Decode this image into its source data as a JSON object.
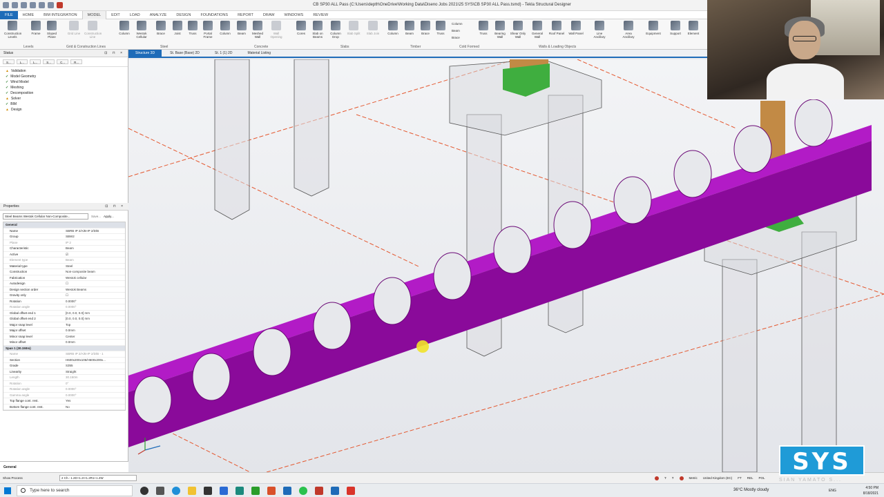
{
  "window": {
    "title": "CB SP30 ALL Pass (C:\\Users\\depth\\OneDrive\\Working Data\\Diseno Jobs 2021\\25 SYS\\CB SP30 ALL Pass.tsmd) - Tekla Structural Designer"
  },
  "menu_tabs": [
    "FILE",
    "HOME",
    "BIM INTEGRATION",
    "MODEL",
    "EDIT",
    "LOAD",
    "ANALYZE",
    "DESIGN",
    "FOUNDATIONS",
    "REPORT",
    "DRAW",
    "WINDOWS",
    "REVIEW"
  ],
  "ribbon": {
    "buttons": [
      {
        "label": "Construction Levels"
      },
      {
        "label": "Frame"
      },
      {
        "label": "Sloped Plane"
      },
      {
        "label": "Grid Line",
        "dim": true
      },
      {
        "label": "Construction Line",
        "dim": true
      },
      {
        "label": "Column"
      },
      {
        "label": "Westok Cellular"
      },
      {
        "label": "Brace"
      },
      {
        "label": "Joist"
      },
      {
        "label": "Truss"
      },
      {
        "label": "Portal Frame"
      },
      {
        "label": "Column"
      },
      {
        "label": "Beam"
      },
      {
        "label": "Meshed Wall"
      },
      {
        "label": "Wall Opening",
        "dim": true
      },
      {
        "label": "Cores"
      },
      {
        "label": "Slab on Beams"
      },
      {
        "label": "Column Drop"
      },
      {
        "label": "Slab Split",
        "dim": true
      },
      {
        "label": "Slab Join",
        "dim": true
      },
      {
        "label": "Column"
      },
      {
        "label": "Beam"
      },
      {
        "label": "Brace"
      },
      {
        "label": "Truss"
      },
      {
        "label": "Truss"
      },
      {
        "label": "Bearing Wall"
      },
      {
        "label": "Shear Only Wall"
      },
      {
        "label": "General Wall"
      },
      {
        "label": "Roof Panel"
      },
      {
        "label": "Wall Panel"
      },
      {
        "label": "Line Ancillary"
      },
      {
        "label": "Area Ancillary"
      },
      {
        "label": "Equipment"
      },
      {
        "label": "Support"
      },
      {
        "label": "Element"
      }
    ],
    "cold_formed_items": [
      "Column",
      "Beam",
      "Brace"
    ],
    "groups": [
      "Levels",
      "Grid & Construction Lines",
      "Steel",
      "Concrete",
      "Slabs",
      "Timber",
      "Cold Formed",
      "Walls & Loading Objects"
    ]
  },
  "status_panel": {
    "title": "Status",
    "controls": "⊡ ⊓ ×",
    "mini_tabs": [
      "S...",
      "L...",
      "L...",
      "S...",
      "C...",
      "R..."
    ],
    "tree": [
      {
        "icon": "warning",
        "label": "Validation"
      },
      {
        "icon": "check",
        "label": "Model Geometry"
      },
      {
        "icon": "check",
        "label": "Wind Model"
      },
      {
        "icon": "check",
        "label": "Meshing"
      },
      {
        "icon": "check",
        "label": "Decomposition"
      },
      {
        "icon": "warning",
        "label": "Solver"
      },
      {
        "icon": "check",
        "label": "BIM"
      },
      {
        "icon": "warning",
        "label": "Design"
      }
    ]
  },
  "properties_panel": {
    "title": "Properties",
    "controls": "⊡ ⊓ ×",
    "selector": "Steel Beams Westok Cellular Non-Composite...",
    "save_label": "Save...",
    "apply_label": "Apply...",
    "rows": [
      {
        "k": "General",
        "sec": true
      },
      {
        "k": "Name",
        "v": "SBRB IP 2/A/B-IP 2/D/B"
      },
      {
        "k": "Group",
        "v": "SBW2"
      },
      {
        "k": "Plane",
        "v": "IP 2",
        "dim": true
      },
      {
        "k": "Characteristic",
        "v": "Beam"
      },
      {
        "k": "Active",
        "v": "☑"
      },
      {
        "k": "Element type",
        "v": "Beam",
        "dim": true
      },
      {
        "k": "Material type",
        "v": "Steel"
      },
      {
        "k": "Construction",
        "v": "Non-composite beam"
      },
      {
        "k": "Fabrication",
        "v": "Westok cellular"
      },
      {
        "k": "Autodesign",
        "v": "☐"
      },
      {
        "k": "Design section order",
        "v": "Westok Beams"
      },
      {
        "k": "Gravity only",
        "v": "☐"
      },
      {
        "k": "Rotation",
        "v": "0.0000°"
      },
      {
        "k": "Rotation angle",
        "v": "0.0000°",
        "dim": true
      },
      {
        "k": "Global offset end 1",
        "v": "[0.0, 0.0, 0.0] mm"
      },
      {
        "k": "Global offset end 2",
        "v": "[0.0, 0.0, 0.0] mm"
      },
      {
        "k": "Major snap level",
        "v": "Top"
      },
      {
        "k": "Major offset",
        "v": "0.0mm"
      },
      {
        "k": "Minor snap level",
        "v": "Center"
      },
      {
        "k": "Minor offset",
        "v": "0.0mm"
      },
      {
        "k": "Span 1 (30.150m)",
        "sec": true
      },
      {
        "k": "Name",
        "v": "SBRB IP 2/A/B-IP 2/D/B - 1",
        "dim": true
      },
      {
        "k": "Section",
        "v": "H600x200x106/H600x200x..."
      },
      {
        "k": "Grade",
        "v": "S355"
      },
      {
        "k": "Linearity",
        "v": "Straight"
      },
      {
        "k": "Length",
        "v": "30.150m",
        "dim": true
      },
      {
        "k": "Rotation",
        "v": "0°",
        "dim": true
      },
      {
        "k": "Rotation angle",
        "v": "0.0000°",
        "dim": true
      },
      {
        "k": "Gamma angle",
        "v": "0.0000°",
        "dim": true
      },
      {
        "k": "Top flange cont. rest.",
        "v": "Yes"
      },
      {
        "k": "Bottom flange cont. rest.",
        "v": "No"
      }
    ],
    "footer": "General"
  },
  "doc_tabs": [
    "Structure 3D",
    "St. Base (Base) 2D",
    "St. 1 (1) 2D",
    "Material Listing"
  ],
  "statusbar": {
    "left": "Show Process",
    "combo": "2 Ch.: 1.2D+1.2I+1.2R1+1.2W",
    "metric": "Metric",
    "locale": "United Kingdom (EC)",
    "unit": "FT",
    "right_labels": [
      "REL",
      "POL"
    ]
  },
  "taskbar": {
    "search_placeholder": "Type here to search",
    "weather": "36°C  Mostly cloudy",
    "time": "4:50 PM",
    "date": "8/18/2021",
    "lang": "ENG"
  },
  "overlay": {
    "logo_text": "SYS",
    "watermark": "SIAN YAMATO S..."
  },
  "colors": {
    "beam": "#8a0a9a",
    "beam_top": "#b21bc6",
    "column_fill": "#e3e4e7",
    "grid_line": "#e4572e",
    "accent": "#1e6bb8",
    "support": "#3fae3f",
    "pad": "#c28a45"
  }
}
